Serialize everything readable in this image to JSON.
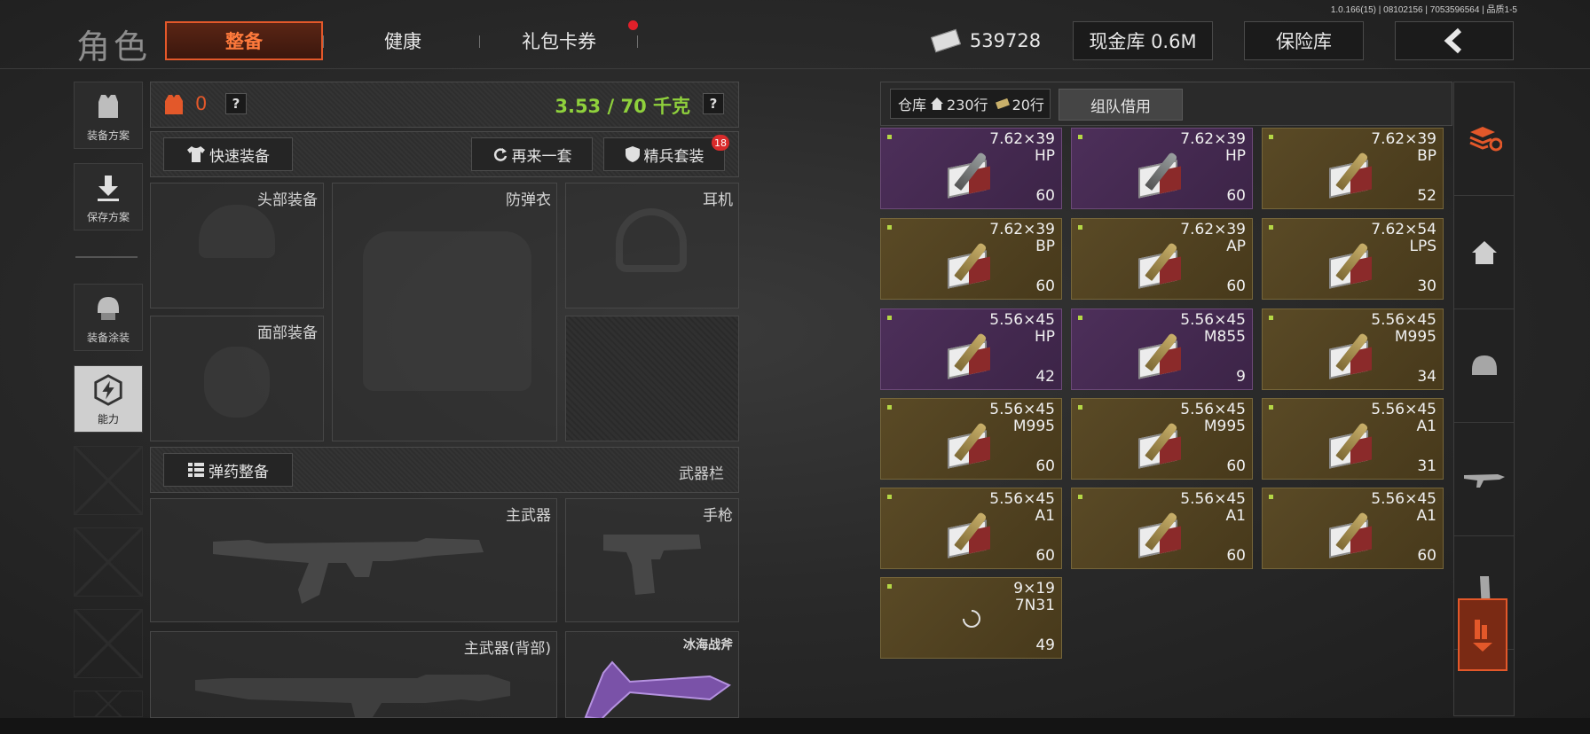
{
  "version": "1.0.166(15) | 08102156 | 7053596564 | 品质1-5",
  "header": {
    "title": "角色",
    "tabs": [
      {
        "label": "整备",
        "active": true
      },
      {
        "label": "健康",
        "active": false
      },
      {
        "label": "礼包卡券",
        "active": false,
        "has_notification": true
      }
    ],
    "cash_icon": "banknote-icon",
    "cash_amount": "539728",
    "cash_vault": "现金库 0.6M",
    "safe_box": "保险库",
    "back_icon": "chevron-left-icon"
  },
  "side": {
    "loadout_plan": "装备方案",
    "save_plan": "保存方案",
    "gear_skin": "装备涂装",
    "ability": "能力"
  },
  "loadout": {
    "armor_count": "0",
    "weight": "3.53 / 70 千克",
    "help": "?",
    "quick_equip": "快速装备",
    "reroll": "再来一套",
    "elite_kit": "精兵套装",
    "elite_badge": "18",
    "slots": {
      "head": "头部装备",
      "armor": "防弹衣",
      "ear": "耳机",
      "face": "面部装备"
    },
    "ammo_prep": "弹药整备",
    "weapon_bar": "武器栏",
    "weapons": {
      "primary": "主武器",
      "pistol": "手枪",
      "primary_back": "主武器(背部)",
      "melee": "冰海战斧"
    }
  },
  "inventory": {
    "storage_label": "仓库",
    "storage_rows": "230行",
    "ticket_rows": "20行",
    "team_borrow": "组队借用",
    "items": [
      {
        "caliber": "7.62×39",
        "type": "HP",
        "count": "60",
        "rarity": "purple",
        "metal": "steel"
      },
      {
        "caliber": "7.62×39",
        "type": "HP",
        "count": "60",
        "rarity": "purple",
        "metal": "steel"
      },
      {
        "caliber": "7.62×39",
        "type": "BP",
        "count": "52",
        "rarity": "gold",
        "metal": "brass"
      },
      {
        "caliber": "7.62×39",
        "type": "BP",
        "count": "60",
        "rarity": "gold",
        "metal": "brass"
      },
      {
        "caliber": "7.62×39",
        "type": "AP",
        "count": "60",
        "rarity": "gold",
        "metal": "brass"
      },
      {
        "caliber": "7.62×54",
        "type": "LPS",
        "count": "30",
        "rarity": "gold",
        "metal": "brass"
      },
      {
        "caliber": "5.56×45",
        "type": "HP",
        "count": "42",
        "rarity": "purple",
        "metal": "brass"
      },
      {
        "caliber": "5.56×45",
        "type": "M855",
        "count": "9",
        "rarity": "purple",
        "metal": "brass"
      },
      {
        "caliber": "5.56×45",
        "type": "M995",
        "count": "34",
        "rarity": "gold",
        "metal": "brass"
      },
      {
        "caliber": "5.56×45",
        "type": "M995",
        "count": "60",
        "rarity": "gold",
        "metal": "brass"
      },
      {
        "caliber": "5.56×45",
        "type": "M995",
        "count": "60",
        "rarity": "gold",
        "metal": "brass"
      },
      {
        "caliber": "5.56×45",
        "type": "A1",
        "count": "31",
        "rarity": "gold",
        "metal": "brass"
      },
      {
        "caliber": "5.56×45",
        "type": "A1",
        "count": "60",
        "rarity": "gold",
        "metal": "brass"
      },
      {
        "caliber": "5.56×45",
        "type": "A1",
        "count": "60",
        "rarity": "gold",
        "metal": "brass"
      },
      {
        "caliber": "5.56×45",
        "type": "A1",
        "count": "60",
        "rarity": "gold",
        "metal": "brass"
      },
      {
        "caliber": "9×19",
        "type": "7N31",
        "count": "49",
        "rarity": "gold",
        "metal": "loading"
      }
    ]
  },
  "right_tabs": [
    "stack-refresh-icon",
    "home-icon",
    "helmet-icon",
    "rifle-icon",
    "magazine-icon",
    "sort-down-icon"
  ],
  "colors": {
    "accent": "#e3582a",
    "weight_green": "#8fd13c",
    "purple_tier": "#4d2f5a",
    "gold_tier": "#5a4a26"
  }
}
